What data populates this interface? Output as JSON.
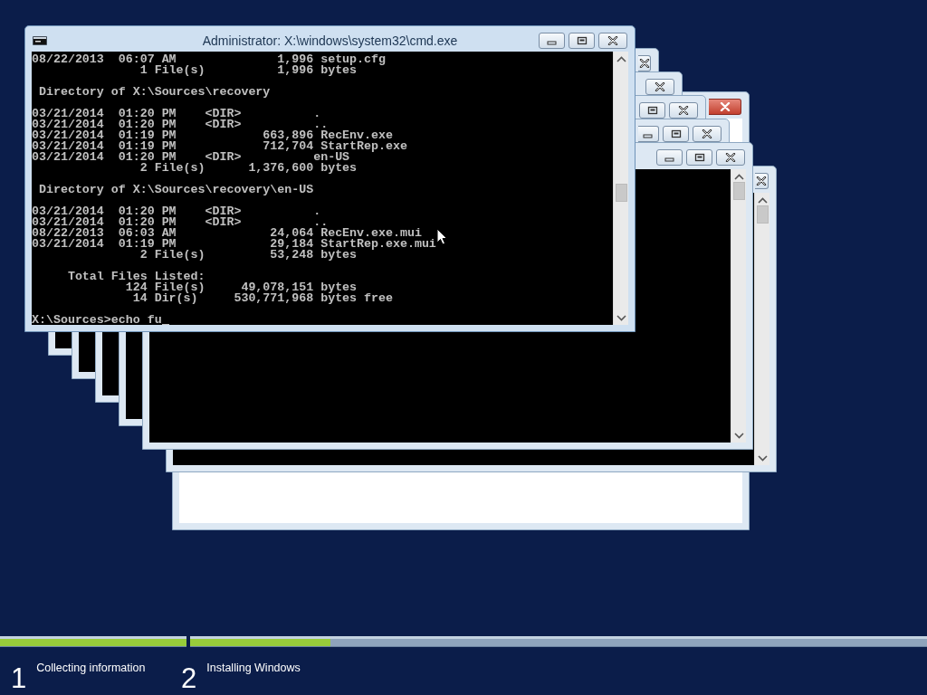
{
  "background_windows": [
    {
      "kind": "setup",
      "close_highlighted": true
    },
    {
      "kind": "console",
      "close_highlighted": false
    },
    {
      "kind": "console",
      "close_highlighted": false
    },
    {
      "kind": "console",
      "close_highlighted": false
    },
    {
      "kind": "console",
      "close_highlighted": false
    },
    {
      "kind": "console",
      "close_highlighted": false
    },
    {
      "kind": "console",
      "close_highlighted": false
    }
  ],
  "console_window": {
    "title": "Administrator: X:\\windows\\system32\\cmd.exe",
    "output_blocks": [
      [
        "08/22/2013  06:07 AM              1,996 setup.cfg",
        "               1 File(s)          1,996 bytes"
      ],
      [
        " Directory of X:\\Sources\\recovery"
      ],
      [
        "03/21/2014  01:20 PM    <DIR>          .",
        "03/21/2014  01:20 PM    <DIR>          ..",
        "03/21/2014  01:19 PM            663,896 RecEnv.exe",
        "03/21/2014  01:19 PM            712,704 StartRep.exe",
        "03/21/2014  01:20 PM    <DIR>          en-US",
        "               2 File(s)      1,376,600 bytes"
      ],
      [
        " Directory of X:\\Sources\\recovery\\en-US"
      ],
      [
        "03/21/2014  01:20 PM    <DIR>          .",
        "03/21/2014  01:20 PM    <DIR>          ..",
        "08/22/2013  06:03 AM             24,064 RecEnv.exe.mui",
        "03/21/2014  01:19 PM             29,184 StartRep.exe.mui",
        "               2 File(s)         53,248 bytes"
      ],
      [
        "     Total Files Listed:",
        "             124 File(s)     49,078,151 bytes",
        "              14 Dir(s)     530,771,968 bytes free"
      ]
    ],
    "prompt": "X:\\Sources>echo fu"
  },
  "setup_steps": [
    {
      "number": "1",
      "label": "Collecting information",
      "level": 1
    },
    {
      "number": "2",
      "label": "Installing Windows",
      "level": 0.19
    }
  ]
}
